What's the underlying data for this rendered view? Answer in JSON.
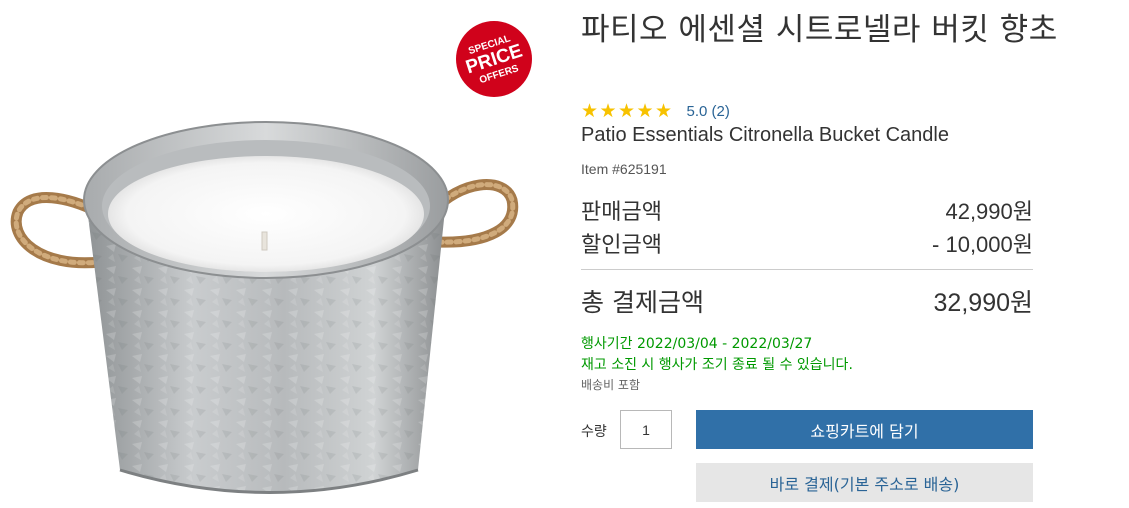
{
  "product": {
    "title": "파티오 에센셜 시트로넬라 버킷 향초",
    "subtitle": "Patio Essentials Citronella Bucket Candle",
    "item_number": "Item #625191",
    "rating": {
      "stars": 5,
      "text": "5.0 (2)"
    },
    "image_icon": "citronella-bucket-candle-photo",
    "badge": {
      "lines": [
        "SPECIAL",
        "PRICE",
        "OFFERS"
      ],
      "color": "#d0021b"
    }
  },
  "pricing": {
    "sale_label": "판매금액",
    "sale_value": "42,990원",
    "discount_label": "할인금액",
    "discount_value": "- 10,000원",
    "total_label": "총 결제금액",
    "total_value": "32,990원"
  },
  "promo": {
    "period": "행사기간 2022/03/04 - 2022/03/27",
    "note": "재고 소진 시 행사가 조기 종료 될 수 있습니다.",
    "shipping": "배송비 포함",
    "color": "#009900"
  },
  "purchase": {
    "qty_label": "수량",
    "qty_value": "1",
    "add_to_cart": "쇼핑카트에 담기",
    "buy_now": "바로 결제(기본 주소로 배송)",
    "primary_color": "#3070a8"
  }
}
